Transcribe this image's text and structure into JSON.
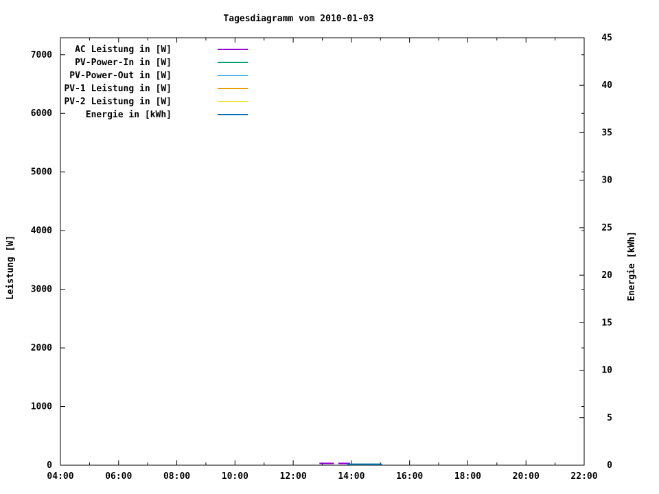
{
  "chart_data": {
    "type": "line",
    "title": "Tagesdiagramm vom 2010-01-03",
    "background_color": "#ffffff",
    "axis_color": "#000000",
    "grid": false,
    "legend_position": "top-left-inside",
    "x_axis": {
      "unit": "time",
      "min_hour": 4,
      "max_hour": 22,
      "major_ticks": [
        {
          "value": 4,
          "label": "04:00"
        },
        {
          "value": 6,
          "label": "06:00"
        },
        {
          "value": 8,
          "label": "08:00"
        },
        {
          "value": 10,
          "label": "10:00"
        },
        {
          "value": 12,
          "label": "12:00"
        },
        {
          "value": 14,
          "label": "14:00"
        },
        {
          "value": 16,
          "label": "16:00"
        },
        {
          "value": 18,
          "label": "18:00"
        },
        {
          "value": 20,
          "label": "20:00"
        },
        {
          "value": 22,
          "label": "22:00"
        }
      ],
      "minor_ticks": [
        5,
        7,
        9,
        11,
        13,
        15,
        17,
        19,
        21
      ]
    },
    "y_left": {
      "label": "Leistung [W]",
      "min": 0,
      "max": 7290,
      "ticks": [
        0,
        1000,
        2000,
        3000,
        4000,
        5000,
        6000,
        7000
      ]
    },
    "y_right": {
      "label": "Energie [kWh]",
      "min": 0,
      "max": 45,
      "ticks": [
        0,
        5,
        10,
        15,
        20,
        25,
        30,
        35,
        40,
        45
      ]
    },
    "series": [
      {
        "name": "AC Leistung in [W]",
        "color": "#9400d3",
        "axis": "left",
        "points": [
          [
            12.9,
            30
          ],
          [
            13.4,
            30
          ],
          null,
          [
            13.55,
            30
          ],
          [
            13.95,
            30
          ]
        ]
      },
      {
        "name": "PV-Power-In in [W]",
        "color": "#009e73",
        "axis": "left",
        "points": [
          [
            13.85,
            15
          ],
          [
            15.0,
            15
          ]
        ]
      },
      {
        "name": "PV-Power-Out in [W]",
        "color": "#56b4e9",
        "axis": "left",
        "points": []
      },
      {
        "name": "PV-1 Leistung in [W]",
        "color": "#e69f00",
        "axis": "left",
        "points": []
      },
      {
        "name": "PV-2 Leistung in [W]",
        "color": "#f0e442",
        "axis": "left",
        "points": []
      },
      {
        "name": "Energie in [kWh]",
        "color": "#0072b2",
        "axis": "right",
        "points": [
          [
            13.85,
            0.1
          ],
          [
            15.05,
            0.1
          ]
        ]
      }
    ]
  }
}
